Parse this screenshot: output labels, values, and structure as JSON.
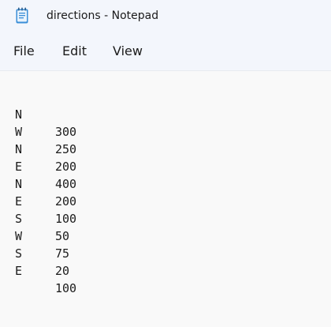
{
  "window": {
    "title": "directions - Notepad",
    "icon": "notepad-icon"
  },
  "menu": {
    "file": "File",
    "edit": "Edit",
    "view": "View"
  },
  "document": {
    "lines": [
      {
        "direction": "N",
        "distance": "300"
      },
      {
        "direction": "W",
        "distance": "250"
      },
      {
        "direction": "N",
        "distance": "200"
      },
      {
        "direction": "E",
        "distance": "400"
      },
      {
        "direction": "N",
        "distance": "200"
      },
      {
        "direction": "E",
        "distance": "100"
      },
      {
        "direction": "S",
        "distance": "50"
      },
      {
        "direction": "W",
        "distance": "75"
      },
      {
        "direction": "S",
        "distance": "20"
      },
      {
        "direction": "E",
        "distance": "100"
      }
    ]
  },
  "colors": {
    "chrome_background": "#f3f6fc",
    "editor_background": "#f9f9f9",
    "text": "#1b1b1b",
    "icon_accent": "#3a8ed8"
  }
}
